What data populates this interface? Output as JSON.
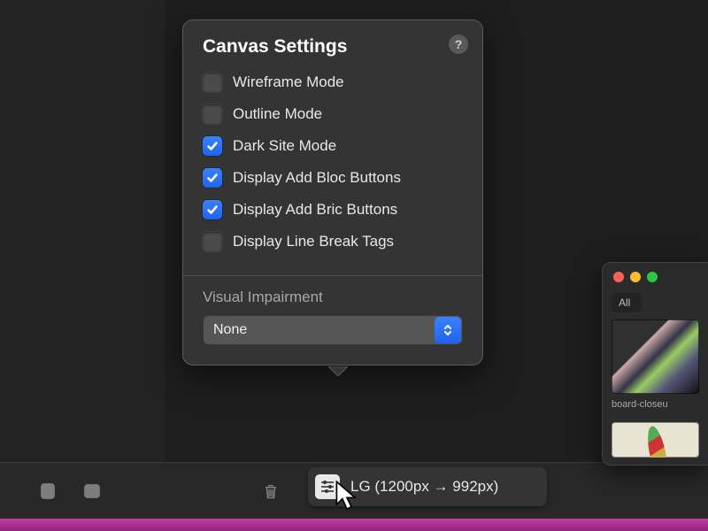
{
  "popover": {
    "title": "Canvas Settings",
    "options": [
      {
        "label": "Wireframe Mode",
        "checked": false
      },
      {
        "label": "Outline Mode",
        "checked": false
      },
      {
        "label": "Dark Site Mode",
        "checked": true
      },
      {
        "label": "Display Add Bloc Buttons",
        "checked": true
      },
      {
        "label": "Display Add Bric Buttons",
        "checked": true
      },
      {
        "label": "Display Line Break Tags",
        "checked": false
      }
    ],
    "visual_impairment": {
      "label": "Visual Impairment",
      "value": "None"
    }
  },
  "breakpoint": {
    "label": "LG (1200px → 992px)"
  },
  "side_panel": {
    "tab": "All",
    "thumb_caption": "board-closeu"
  },
  "help_glyph": "?"
}
